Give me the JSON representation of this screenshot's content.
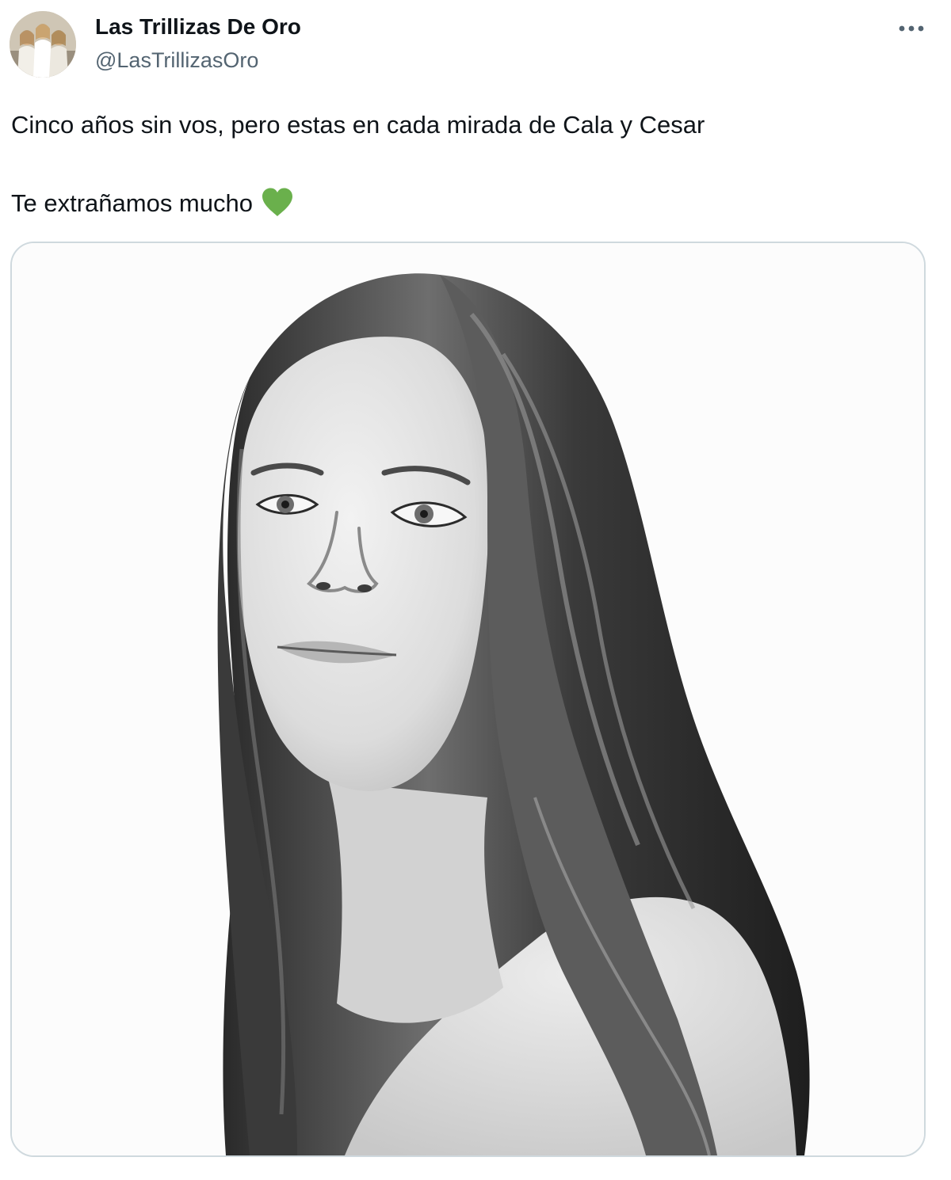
{
  "author": {
    "display_name": "Las Trillizas De Oro",
    "handle": "@LasTrillizasOro",
    "avatar_icon": "profile-photo"
  },
  "menu": {
    "more_icon": "more-horizontal-icon"
  },
  "tweet": {
    "line1": "Cinco años sin vos, pero estas en cada mirada de Cala y Cesar",
    "line2": "Te extrañamos mucho",
    "emoji": "green-heart-icon"
  },
  "media": {
    "type": "black-and-white portrait photo"
  },
  "colors": {
    "text": "#0f1419",
    "secondary_text": "#536471",
    "border": "#cfd9de",
    "heart": "#6ab04c"
  }
}
